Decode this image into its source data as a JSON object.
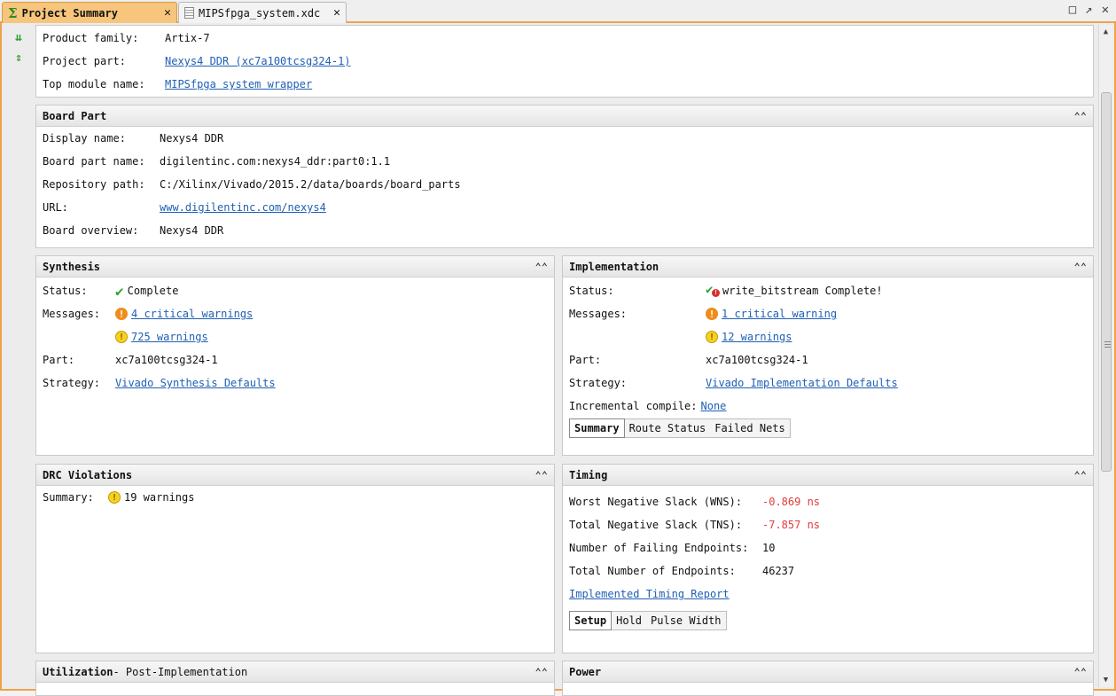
{
  "tabs": [
    {
      "label": "Project Summary",
      "active": true,
      "icon": "sigma-icon"
    },
    {
      "label": "MIPSfpga_system.xdc",
      "active": false,
      "icon": "file-icon"
    }
  ],
  "window_controls": {
    "maximize": "□",
    "float": "↗",
    "close": "✕"
  },
  "left_toolbar": [
    {
      "icon": "collapse-all-icon",
      "glyph": "⇊"
    },
    {
      "icon": "expand-all-icon",
      "glyph": "⇕"
    }
  ],
  "overview": {
    "product_family_label": "Product family:",
    "product_family_value": "Artix-7",
    "project_part_label": "Project part:",
    "project_part_value": "Nexys4 DDR (xc7a100tcsg324-1)",
    "top_module_label": "Top module name:",
    "top_module_value": "MIPSfpga system wrapper"
  },
  "board_part": {
    "title": "Board Part",
    "collapse_glyph": "⌃",
    "display_name_label": "Display name:",
    "display_name_value": "Nexys4 DDR",
    "board_part_name_label": "Board part name:",
    "board_part_name_value": "digilentinc.com:nexys4_ddr:part0:1.1",
    "repository_path_label": "Repository path:",
    "repository_path_value": "C:/Xilinx/Vivado/2015.2/data/boards/board_parts",
    "url_label": "URL:",
    "url_value": "www.digilentinc.com/nexys4",
    "board_overview_label": "Board overview:",
    "board_overview_value": "Nexys4 DDR"
  },
  "synthesis": {
    "title": "Synthesis",
    "status_label": "Status:",
    "status_value": "Complete",
    "messages_label": "Messages:",
    "critical_warnings": "4 critical warnings",
    "warnings": "725 warnings",
    "part_label": "Part:",
    "part_value": "xc7a100tcsg324-1",
    "strategy_label": "Strategy:",
    "strategy_value": "Vivado Synthesis Defaults"
  },
  "implementation": {
    "title": "Implementation",
    "status_label": "Status:",
    "status_value": "write_bitstream Complete!",
    "messages_label": "Messages:",
    "critical_warnings": "1 critical warning",
    "warnings": "12 warnings",
    "part_label": "Part:",
    "part_value": "xc7a100tcsg324-1",
    "strategy_label": "Strategy:",
    "strategy_value": "Vivado Implementation Defaults",
    "incremental_label": "Incremental compile:",
    "incremental_value": "None",
    "subtabs": [
      "Summary",
      "Route Status",
      "Failed Nets"
    ]
  },
  "drc": {
    "title": "DRC Violations",
    "summary_label": "Summary:",
    "summary_value": "19 warnings"
  },
  "timing": {
    "title": "Timing",
    "wns_label": "Worst Negative Slack (WNS):",
    "wns_value": "-0.869 ns",
    "tns_label": "Total Negative Slack (TNS):",
    "tns_value": "-7.857 ns",
    "failing_label": "Number of Failing Endpoints:",
    "failing_value": "10",
    "total_label": "Total Number of Endpoints:",
    "total_value": "46237",
    "report_link": "Implemented Timing Report",
    "subtabs": [
      "Setup",
      "Hold",
      "Pulse Width"
    ]
  },
  "utilization": {
    "title": "Utilization",
    "subtitle": " - Post-Implementation"
  },
  "power": {
    "title": "Power"
  },
  "colors": {
    "accent_orange": "#f0a24a",
    "link_blue": "#1f5fb4",
    "negative_red": "#e53a3a"
  }
}
